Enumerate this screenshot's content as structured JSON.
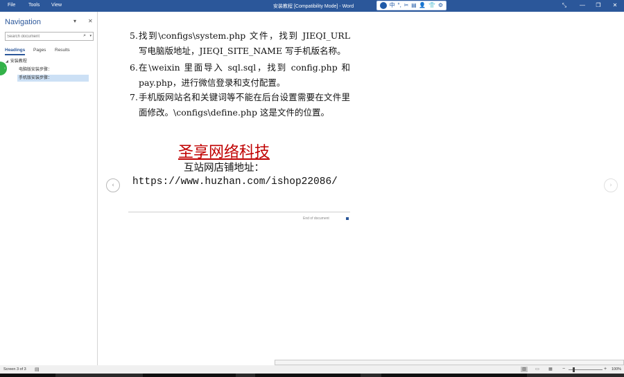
{
  "titlebar": {
    "menus": [
      "File",
      "Tools",
      "View"
    ],
    "doc_title": "安装教程 [Compatibility Mode] - Word",
    "ime_toolbar": [
      "中",
      "°,",
      "✂",
      "▤",
      "👤",
      "👕",
      "⚙"
    ],
    "window_controls": [
      "⤡",
      "—",
      "❐",
      "✕"
    ]
  },
  "navigation": {
    "title": "Navigation",
    "search_placeholder": "Search document",
    "tabs": [
      "Headings",
      "Pages",
      "Results"
    ],
    "tree": {
      "root": "安装教程",
      "children": [
        "电脑版安装步骤：",
        "手机版安装步骤："
      ],
      "selected_index": 1
    }
  },
  "document": {
    "list_items": [
      {
        "number": "5.",
        "text": "找到\\configs\\system.php 文件，找到 JIEQI_URL 写电脑版地址，JIEQI_SITE_NAME 写手机版名称。"
      },
      {
        "number": "6.",
        "text": "在\\weixin 里面导入 sql.sql，找到 config.php 和 pay.php，进行微信登录和支付配置。"
      },
      {
        "number": "7.",
        "text": "手机版网站名和关键词等不能在后台设置需要在文件里面修改。\\configs\\define.php 这是文件的位置。"
      }
    ],
    "company_name": "圣享网络科技",
    "store_label": "互站网店铺地址：",
    "store_url": "https://www.huzhan.com/ishop22086/",
    "end_label": "End of document"
  },
  "statusbar": {
    "page_info": "Screen 3 of 3",
    "zoom_minus": "−",
    "zoom_plus": "+",
    "zoom_level": "100%"
  },
  "colors": {
    "ribbon": "#2b579a",
    "company_red": "#c00000",
    "selection": "#cce0f5"
  }
}
